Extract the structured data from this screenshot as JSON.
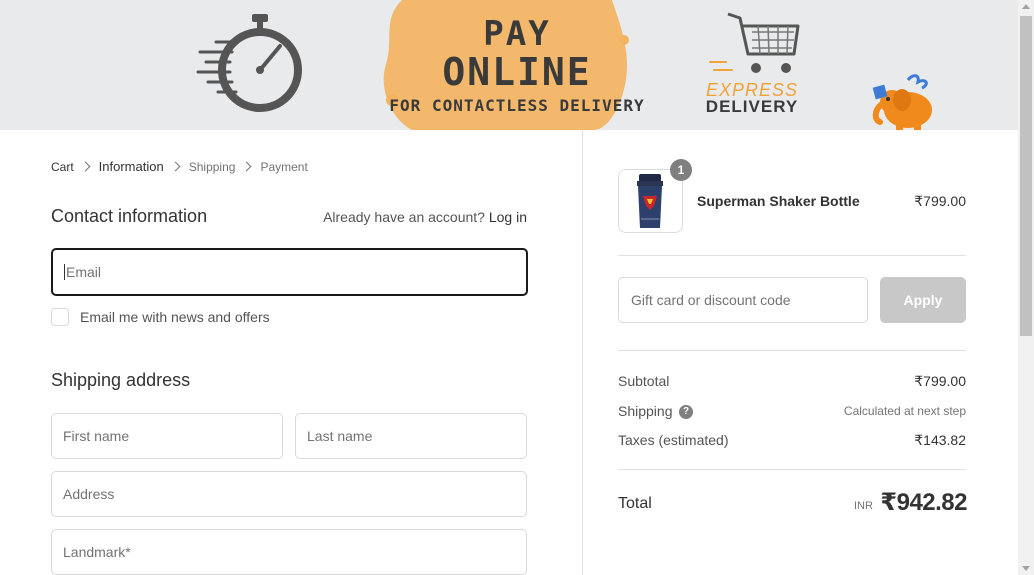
{
  "banner": {
    "pay_line1": "PAY",
    "pay_line2": "ONLINE",
    "pay_line3": "FOR CONTACTLESS DELIVERY",
    "express_line1": "EXPRESS",
    "express_line2": "DELIVERY",
    "accent_color": "#f0a23a"
  },
  "breadcrumb": {
    "items": [
      "Cart",
      "Information",
      "Shipping",
      "Payment"
    ],
    "active": "Information"
  },
  "contact": {
    "title": "Contact information",
    "account_prompt": "Already have an account?",
    "login_link": "Log in",
    "email_placeholder": "Email",
    "newsletter_label": "Email me with news and offers"
  },
  "shipping": {
    "title": "Shipping address",
    "first_name_placeholder": "First name",
    "last_name_placeholder": "Last name",
    "address_placeholder": "Address",
    "landmark_placeholder": "Landmark*"
  },
  "order": {
    "product": {
      "name": "Superman Shaker Bottle",
      "price": "₹799.00",
      "quantity": "1"
    },
    "discount_placeholder": "Gift card or discount code",
    "apply_label": "Apply",
    "subtotal_label": "Subtotal",
    "subtotal_value": "₹799.00",
    "shipping_label": "Shipping",
    "shipping_value": "Calculated at next step",
    "taxes_label": "Taxes (estimated)",
    "taxes_value": "₹143.82",
    "total_label": "Total",
    "total_currency": "INR",
    "total_value": "₹942.82"
  }
}
